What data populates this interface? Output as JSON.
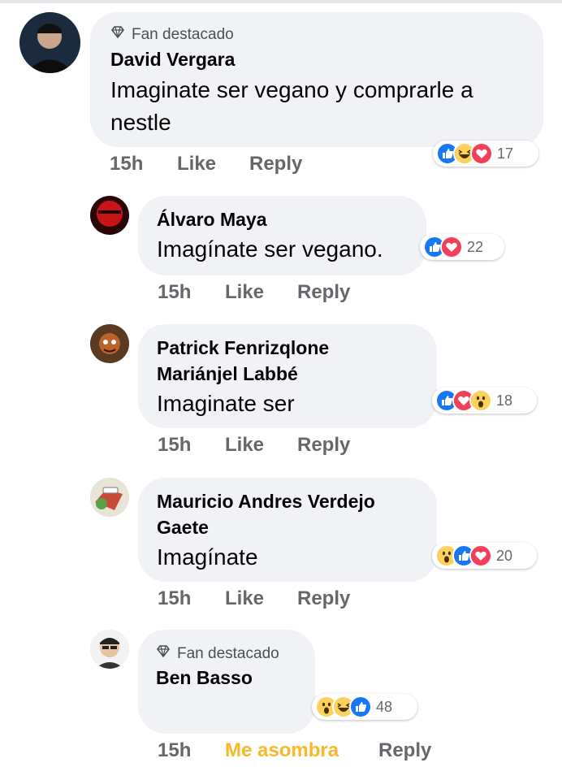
{
  "comments": [
    {
      "badge": "Fan destacado",
      "author": "David Vergara",
      "text_lines": [
        "Imaginate ser vegano y comprarle a",
        "nestle"
      ],
      "time": "15h",
      "like": "Like",
      "reply": "Reply",
      "reactions": [
        "like",
        "haha",
        "love"
      ],
      "reaction_count": "17"
    },
    {
      "author": "Álvaro Maya",
      "text_lines": [
        "Imagínate ser vegano."
      ],
      "time": "15h",
      "like": "Like",
      "reply": "Reply",
      "reactions": [
        "like",
        "love"
      ],
      "reaction_count": "22"
    },
    {
      "author_lines": [
        "Patrick Fenrizqlone",
        "Mariánjel Labbé"
      ],
      "text_lines": [
        "Imaginate ser"
      ],
      "time": "15h",
      "like": "Like",
      "reply": "Reply",
      "reactions": [
        "like",
        "love",
        "wow"
      ],
      "reaction_count": "18"
    },
    {
      "author_lines": [
        "Mauricio Andres Verdejo",
        "Gaete"
      ],
      "text_lines": [
        "Imagínate"
      ],
      "time": "15h",
      "like": "Like",
      "reply": "Reply",
      "reactions": [
        "wow",
        "like",
        "love"
      ],
      "reaction_count": "20"
    },
    {
      "badge": "Fan destacado",
      "author": "Ben Basso",
      "time": "15h",
      "like": "Me asombra",
      "reply": "Reply",
      "reactions": [
        "wow",
        "haha",
        "like"
      ],
      "reaction_count": "48"
    }
  ],
  "colors": {
    "bubble": "#f0f2f5",
    "meta_text": "#65676b",
    "wow_label": "#f7b928",
    "like_blue": "#1877f2",
    "love_red": "#f33e58",
    "emoji_yellow": "#fcd15c"
  },
  "icons": {
    "badge": "diamond-badge-icon",
    "like": "like-reaction-icon",
    "love": "love-reaction-icon",
    "haha": "haha-reaction-icon",
    "wow": "wow-reaction-icon"
  }
}
